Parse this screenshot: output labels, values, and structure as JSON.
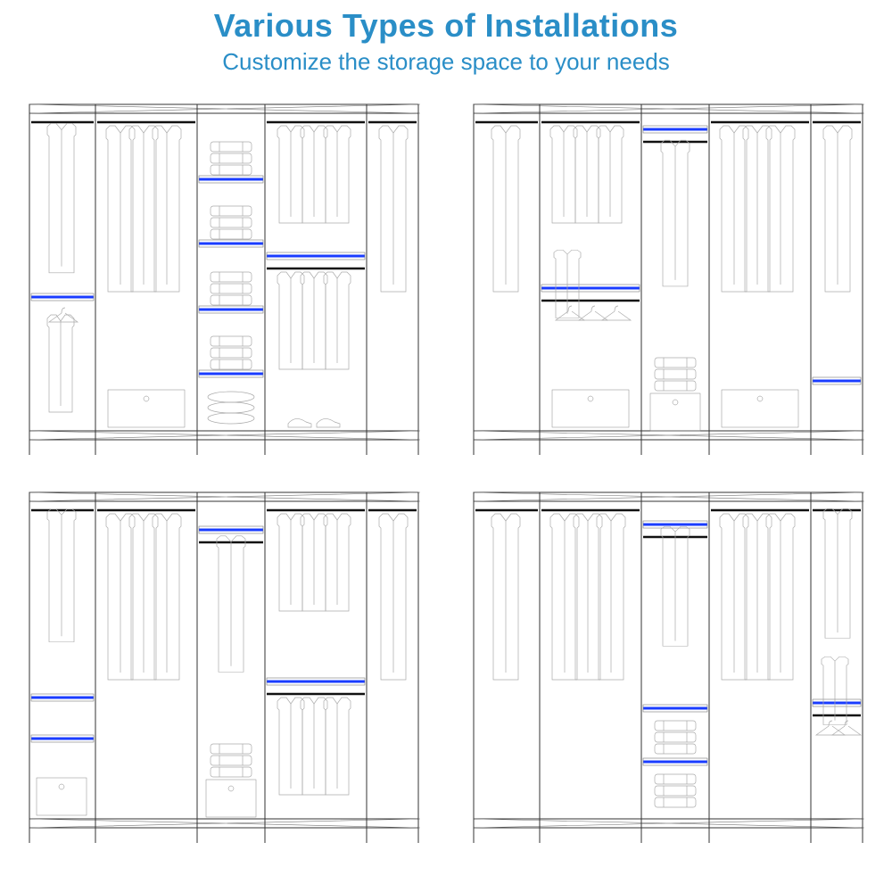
{
  "header": {
    "title": "Various Types of Installations",
    "subtitle": "Customize the storage space to your needs"
  },
  "accent_color": "#2a8ec7",
  "shelf_highlight_color": "#1a3cff",
  "configs": [
    {
      "id": "A",
      "columns": [
        "narrow",
        "wide",
        "narrow",
        "wide",
        "narrow"
      ],
      "middle_shelves": 4,
      "notes": "col1 split, col3 stacked shelves, col4 split, drawers bottom col2 col4"
    },
    {
      "id": "B",
      "columns": [
        "narrow",
        "wide",
        "narrow",
        "wide",
        "narrow"
      ],
      "notes": "blue shelf top col3, col2 split, drawers bottom col2 col3 col4, col5 single shelf low"
    },
    {
      "id": "C",
      "columns": [
        "narrow",
        "wide",
        "narrow",
        "wide",
        "narrow"
      ],
      "notes": "col3 blue shelf upper, col1 two shelves lower, col4 blue shelf mid, drawers col1 col3"
    },
    {
      "id": "D",
      "columns": [
        "narrow",
        "wide",
        "narrow",
        "wide",
        "narrow"
      ],
      "notes": "col3 blue shelf upper + stacked clothes, col5 blue shelf mid + hangers"
    }
  ]
}
